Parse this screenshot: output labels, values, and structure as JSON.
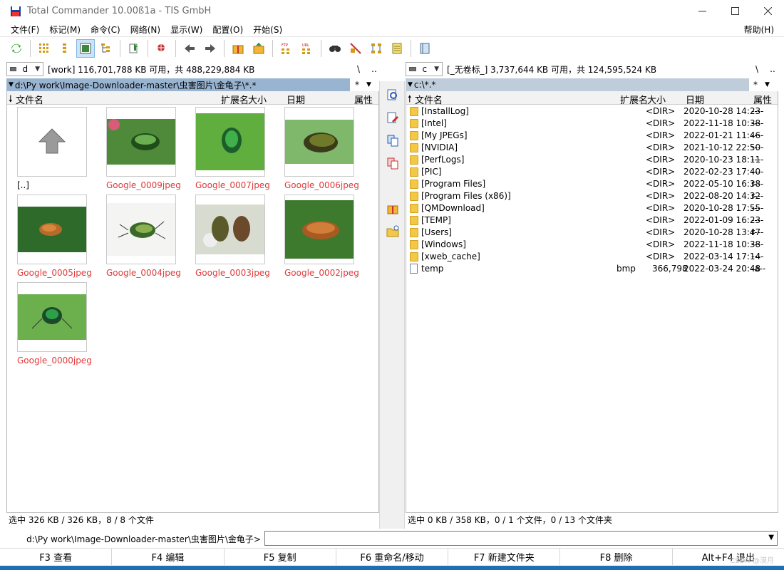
{
  "window": {
    "title": "Total Commander 10.00ß1a - TIS GmbH"
  },
  "menu": {
    "items": [
      "文件(F)",
      "标记(M)",
      "命令(C)",
      "网络(N)",
      "显示(W)",
      "配置(O)",
      "开始(S)"
    ],
    "help": "帮助(H)"
  },
  "left": {
    "drive": "d",
    "drive_info": "[work]  116,701,788 KB 可用，共 488,229,884 KB",
    "path": "d:\\Py work\\Image-Downloader-master\\虫害图片\\金龟子\\*.*",
    "filter": "*",
    "root": "\\",
    "up": "..",
    "headers": {
      "name": "文件名",
      "ext": "扩展名",
      "size": "大小",
      "date": "日期",
      "attr": "属性"
    },
    "thumbs": [
      {
        "name": "[..]",
        "ext": ""
      },
      {
        "name": "Google_0009",
        "ext": "jpeg"
      },
      {
        "name": "Google_0007",
        "ext": "jpeg"
      },
      {
        "name": "Google_0006",
        "ext": "jpeg"
      },
      {
        "name": "Google_0005",
        "ext": "jpeg"
      },
      {
        "name": "Google_0004",
        "ext": "jpeg"
      },
      {
        "name": "Google_0003",
        "ext": "jpeg"
      },
      {
        "name": "Google_0002",
        "ext": "jpeg"
      },
      {
        "name": "Google_0000",
        "ext": "jpeg"
      }
    ],
    "status": "选中 326 KB / 326 KB，8 / 8 个文件"
  },
  "right": {
    "drive": "c",
    "drive_info": "[_无卷标_]  3,737,644 KB 可用，共 124,595,524 KB",
    "path": "c:\\*.*",
    "filter": "*",
    "root": "\\",
    "up": "..",
    "headers": {
      "name": "文件名",
      "ext": "扩展名",
      "size": "大小",
      "date": "日期",
      "attr": "属性"
    },
    "files": [
      {
        "name": "[InstallLog]",
        "ext": "",
        "size": "<DIR>",
        "date": "2020-10-28 14:23",
        "attr": "----",
        "type": "folder"
      },
      {
        "name": "[Intel]",
        "ext": "",
        "size": "<DIR>",
        "date": "2022-11-18 10:38",
        "attr": "----",
        "type": "folder"
      },
      {
        "name": "[My JPEGs]",
        "ext": "",
        "size": "<DIR>",
        "date": "2022-01-21 11:46",
        "attr": "----",
        "type": "folder"
      },
      {
        "name": "[NVIDIA]",
        "ext": "",
        "size": "<DIR>",
        "date": "2021-10-12 22:50",
        "attr": "----",
        "type": "folder"
      },
      {
        "name": "[PerfLogs]",
        "ext": "",
        "size": "<DIR>",
        "date": "2020-10-23 18:11",
        "attr": "----",
        "type": "folder"
      },
      {
        "name": "[PIC]",
        "ext": "",
        "size": "<DIR>",
        "date": "2022-02-23 17:40",
        "attr": "----",
        "type": "folder"
      },
      {
        "name": "[Program Files]",
        "ext": "",
        "size": "<DIR>",
        "date": "2022-05-10 16:38",
        "attr": "r---",
        "type": "folder"
      },
      {
        "name": "[Program Files (x86)]",
        "ext": "",
        "size": "<DIR>",
        "date": "2022-08-20 14:32",
        "attr": "r---",
        "type": "folder"
      },
      {
        "name": "[QMDownload]",
        "ext": "",
        "size": "<DIR>",
        "date": "2020-10-28 17:55",
        "attr": "----",
        "type": "folder"
      },
      {
        "name": "[TEMP]",
        "ext": "",
        "size": "<DIR>",
        "date": "2022-01-09 16:23",
        "attr": "----",
        "type": "folder"
      },
      {
        "name": "[Users]",
        "ext": "",
        "size": "<DIR>",
        "date": "2020-10-28 13:47",
        "attr": "r---",
        "type": "folder"
      },
      {
        "name": "[Windows]",
        "ext": "",
        "size": "<DIR>",
        "date": "2022-11-18 10:38",
        "attr": "----",
        "type": "folder"
      },
      {
        "name": "[xweb_cache]",
        "ext": "",
        "size": "<DIR>",
        "date": "2022-03-14 17:14",
        "attr": "----",
        "type": "folder"
      },
      {
        "name": "temp",
        "ext": "bmp",
        "size": "366,798",
        "date": "2022-03-24 20:48",
        "attr": "-a--",
        "type": "file"
      }
    ],
    "status": "选中 0 KB / 358 KB，0 / 1 个文件，0 / 13 个文件夹"
  },
  "cmdline": {
    "label": "d:\\Py work\\Image-Downloader-master\\虫害图片\\金龟子>"
  },
  "fkeys": [
    "F3 查看",
    "F4 编辑",
    "F5 复制",
    "F6 重命名/移动",
    "F7 新建文件夹",
    "F8 删除",
    "Alt+F4 退出"
  ],
  "watermark": "CSDN @漠月",
  "colors": {
    "active_path": "#99b4d1",
    "inactive_path": "#bfcddb",
    "thumb_label": "#e03a3a"
  }
}
